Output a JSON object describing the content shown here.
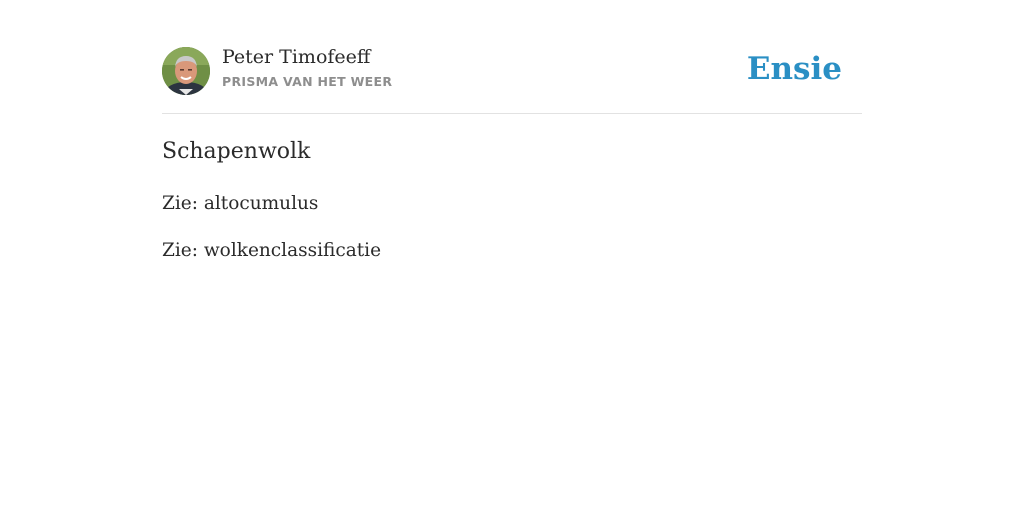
{
  "header": {
    "author_name": "Peter Timofeeff",
    "source": "PRISMA VAN HET WEER",
    "brand": "Ensie",
    "brand_color": "#2a8fc4"
  },
  "article": {
    "title": "Schapenwolk",
    "references": [
      {
        "prefix": "Zie:",
        "term": "altocumulus"
      },
      {
        "prefix": "Zie:",
        "term": "wolkenclassificatie"
      }
    ]
  }
}
